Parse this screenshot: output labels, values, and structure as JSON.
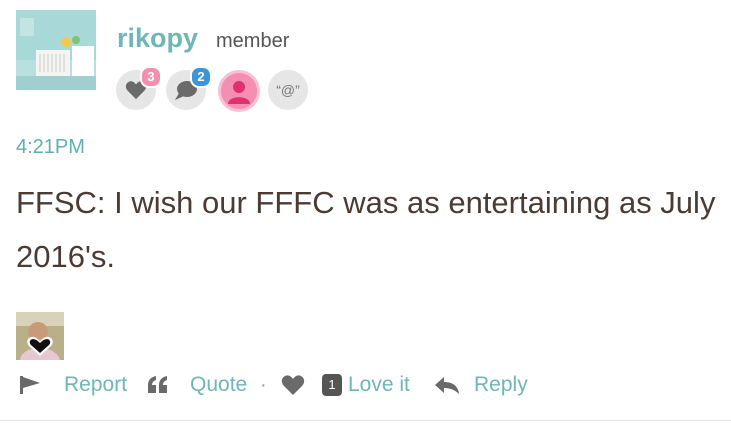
{
  "post": {
    "author": {
      "name": "rikopy",
      "role": "member"
    },
    "badges": [
      {
        "icon": "heart-icon",
        "count": "3",
        "count_color": "#f48fb1"
      },
      {
        "icon": "comment-icon",
        "count": "2",
        "count_color": "#3d94d6"
      },
      {
        "icon": "user-icon",
        "count": "",
        "count_color": ""
      },
      {
        "icon": "mention-icon",
        "label": "“@”"
      }
    ],
    "time": "4:21PM",
    "body": "FFSC: I wish our FFFC was as entertaining as July 2016's."
  },
  "actions": {
    "report": "Report",
    "quote": "Quote",
    "separator": "·",
    "love_count": "1",
    "love": "Love it",
    "reply": "Reply"
  },
  "colors": {
    "accent": "#6fb6b4",
    "text": "#4a3b33",
    "icon_gray": "#6a6a6a"
  }
}
